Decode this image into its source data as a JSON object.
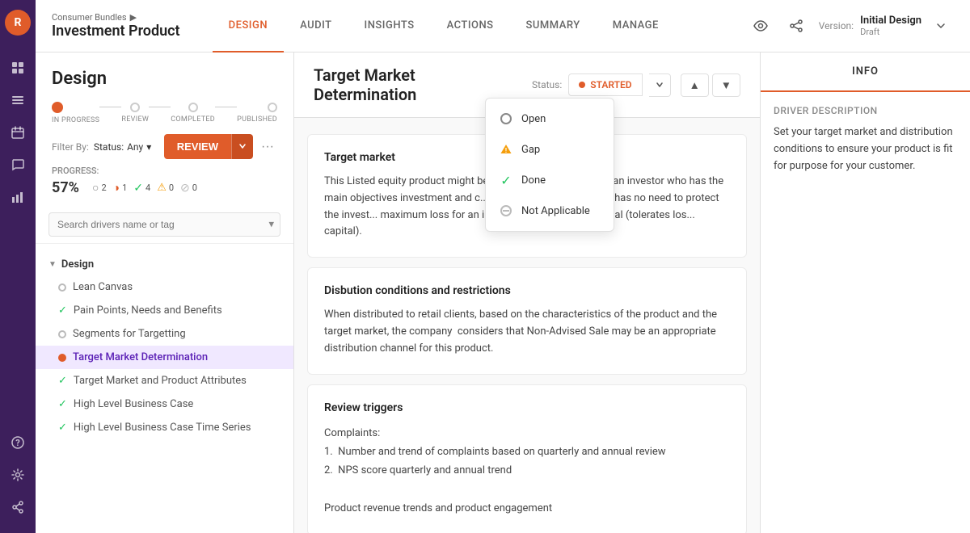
{
  "sidebar": {
    "app_icon": "R",
    "icons": [
      "grid-icon",
      "list-icon",
      "calendar-icon",
      "chat-icon",
      "chart-icon"
    ],
    "bottom_icons": [
      "help-icon",
      "settings-icon",
      "share-icon"
    ]
  },
  "topnav": {
    "breadcrumb": "Consumer Bundles",
    "breadcrumb_arrow": "▶",
    "page_title": "Investment Product",
    "tabs": [
      {
        "label": "DESIGN",
        "active": true
      },
      {
        "label": "AUDIT",
        "active": false
      },
      {
        "label": "INSIGHTS",
        "active": false
      },
      {
        "label": "ACTIONS",
        "active": false
      },
      {
        "label": "SUMMARY",
        "active": false
      },
      {
        "label": "MANAGE",
        "active": false
      }
    ],
    "eye_icon": "👁",
    "share_icon": "⤴",
    "version_label": "Version:",
    "version_name": "Initial Design",
    "version_sub": "Draft"
  },
  "progress_timeline": {
    "steps": [
      {
        "label": "IN PROGRESS",
        "state": "active"
      },
      {
        "label": "REVIEW",
        "state": "done"
      },
      {
        "label": "COMPLETED",
        "state": "done"
      },
      {
        "label": "PUBLISHED",
        "state": "done"
      }
    ]
  },
  "review_button": {
    "label": "REVIEW",
    "more_dots": "···"
  },
  "filter": {
    "label": "Filter By:",
    "status_label": "Status:",
    "status_value": "Any",
    "dropdown_arrow": "▾"
  },
  "progress_stats": {
    "label": "PROGRESS:",
    "percent": "57%",
    "items": [
      {
        "icon": "○",
        "count": "2"
      },
      {
        "icon": "◑",
        "count": "1"
      },
      {
        "icon": "✓",
        "count": "4"
      },
      {
        "icon": "⚠",
        "count": "0"
      },
      {
        "icon": "⊘",
        "count": "0"
      }
    ]
  },
  "search": {
    "placeholder": "Search drivers name or tag"
  },
  "nav_tree": {
    "section": {
      "label": "Design",
      "items": [
        {
          "label": "Lean Canvas",
          "status": "open",
          "active": false
        },
        {
          "label": "Pain Points, Needs and Benefits",
          "status": "done",
          "active": false
        },
        {
          "label": "Segments for Targetting",
          "status": "open",
          "active": false
        },
        {
          "label": "Target Market Determination",
          "status": "active",
          "active": true
        },
        {
          "label": "Target Market and Product Attributes",
          "status": "done",
          "active": false
        },
        {
          "label": "High Level Business Case",
          "status": "done",
          "active": false
        },
        {
          "label": "High Level Business Case Time Series",
          "status": "done",
          "active": false
        }
      ]
    }
  },
  "driver": {
    "title": "Target Market Determination",
    "status_label": "Status:",
    "status": "STARTED",
    "dropdown_items": [
      {
        "label": "Open",
        "type": "open"
      },
      {
        "label": "Gap",
        "type": "gap"
      },
      {
        "label": "Done",
        "type": "done"
      },
      {
        "label": "Not Applicable",
        "type": "na"
      }
    ]
  },
  "content_sections": [
    {
      "id": "target_market",
      "title": "Target market",
      "text": "This Listed equity product might be generally compatible with an investor who has the main objectives investment and c... The potential end investor has no need to protect the invest... maximum loss for an investor is the invested capital (tolerates los... capital)."
    },
    {
      "id": "disbution",
      "title": "Disbution conditions and restrictions",
      "text": "When distributed to retail clients, based on the characteristics of the product and the target market, the company  considers that Non-Advised Sale may be an appropriate distribution channel for this product."
    },
    {
      "id": "review_triggers",
      "title": "Review triggers",
      "items": [
        "Complaints:",
        "1.  Number and trend of complaints based on quarterly and annual review",
        "2.  NPS score quarterly and annual trend",
        "",
        "Product revenue trends and product engagement"
      ]
    }
  ],
  "info_panel": {
    "tab_label": "INFO",
    "driver_description_label": "Driver Description",
    "driver_description_text": "Set your target market and distribution conditions to ensure your product is fit for purpose for your customer."
  }
}
